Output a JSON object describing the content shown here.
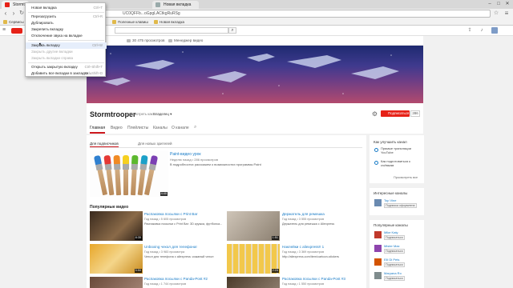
{
  "browser": {
    "tabs": [
      {
        "label": "Stormtr"
      },
      {
        "label": "Новая вкладка"
      }
    ],
    "address": "UC0QFFb...oGpgLACtkgRuRSg",
    "bookmarks": [
      "Сервисы",
      "Полезные клавиш",
      "Новая вкладка"
    ]
  },
  "context_menu": {
    "items": [
      {
        "label": "Новая вкладка",
        "shortcut": "Ctrl+T",
        "enabled": true
      },
      {
        "label": "Перезагрузить",
        "shortcut": "Ctrl+R",
        "enabled": true
      },
      {
        "label": "Дублировать",
        "shortcut": "",
        "enabled": true
      },
      {
        "label": "Закрепить вкладку",
        "shortcut": "",
        "enabled": true
      },
      {
        "label": "Отключение звука на вкладке",
        "shortcut": "",
        "enabled": true
      },
      {
        "label": "Закрыть вкладку",
        "shortcut": "Ctrl+W",
        "enabled": true
      },
      {
        "label": "Закрыть другие вкладки",
        "shortcut": "",
        "enabled": false
      },
      {
        "label": "Закрыть вкладки справа",
        "shortcut": "",
        "enabled": false
      },
      {
        "label": "Открыть закрытую вкладку",
        "shortcut": "Ctrl+Shift+T",
        "enabled": true
      },
      {
        "label": "Добавить все вкладки в закладки...",
        "shortcut": "Ctrl+Shift+D",
        "enabled": true
      }
    ]
  },
  "channel": {
    "stats": [
      "30 475 просмотров",
      "Менеджер видео"
    ],
    "name": "Stormtrooper",
    "view_as_label": "Просмотреть как",
    "view_as_value": "Владелец",
    "subscribe_label": "Подписаться",
    "subscriber_count": "286",
    "tabs": [
      "Главная",
      "Видео",
      "Плейлисты",
      "Каналы",
      "О канале"
    ]
  },
  "main": {
    "tabs": [
      "Для подписчиков",
      "Для новых зрителей"
    ],
    "featured": {
      "title": "Paint-видео урок",
      "meta": "Неделю назад • 286 просмотров",
      "desc": "В подробностях расскажем о возможностях программы Paint",
      "duration": "4:40"
    },
    "popular_title": "Популярные видео",
    "videos": [
      {
        "title": "Распаковка посылки с Print Bar",
        "meta": "Год назад • 5 605 просмотров",
        "desc": "Распаковка посылки с Print Bar: 3D кружка, футболка...",
        "duration": "8:35"
      },
      {
        "title": "Держатель для ремешка",
        "meta": "Год назад • 3 555 просмотров",
        "desc": "Держатель для ремешка с Aliexpress",
        "duration": "1:51"
      },
      {
        "title": "Unboxing чехол для телефона!",
        "meta": "Год назад • 3 983 просмотра",
        "desc": "Чехол для телефона с aliexpress: кожаный чехол",
        "duration": "5:50"
      },
      {
        "title": "Наклейки с aliexpress!! 1",
        "meta": "Год назад • 3 369 просмотров",
        "desc": "http://aliexpress.com/item/cartoon-stickers",
        "duration": "2:24"
      },
      {
        "title": "Распаковка посылки с Panda-Post #2",
        "meta": "Год назад • 1 744 просмотров",
        "desc": "",
        "duration": ""
      },
      {
        "title": "Распаковка посылки с Panda-Post #3",
        "meta": "Год назад • 1 550 просмотров",
        "desc": "",
        "duration": ""
      }
    ]
  },
  "sidebar": {
    "improve_title": "Как улучшить канал",
    "options": [
      "Прямые трансляции YouTube",
      "Как подготовиться к съёмкам"
    ],
    "view_all": "Просмотреть все",
    "interesting_title": "Интересные каналы",
    "interesting": [
      {
        "name": "Top Vine",
        "sub": "Подписка оформлена"
      }
    ],
    "popular_title": "Популярные каналы",
    "popular": [
      {
        "name": "Mike Katy",
        "sub": "Подписаться",
        "color": "#c0392b"
      },
      {
        "name": "Mister Max",
        "sub": "Подписаться",
        "color": "#8e44ad"
      },
      {
        "name": "Elli Di Pets",
        "sub": "Подписаться",
        "color": "#d35400"
      },
      {
        "name": "Maryana Ro",
        "sub": "Подписаться",
        "color": "#7f8c8d"
      }
    ]
  }
}
